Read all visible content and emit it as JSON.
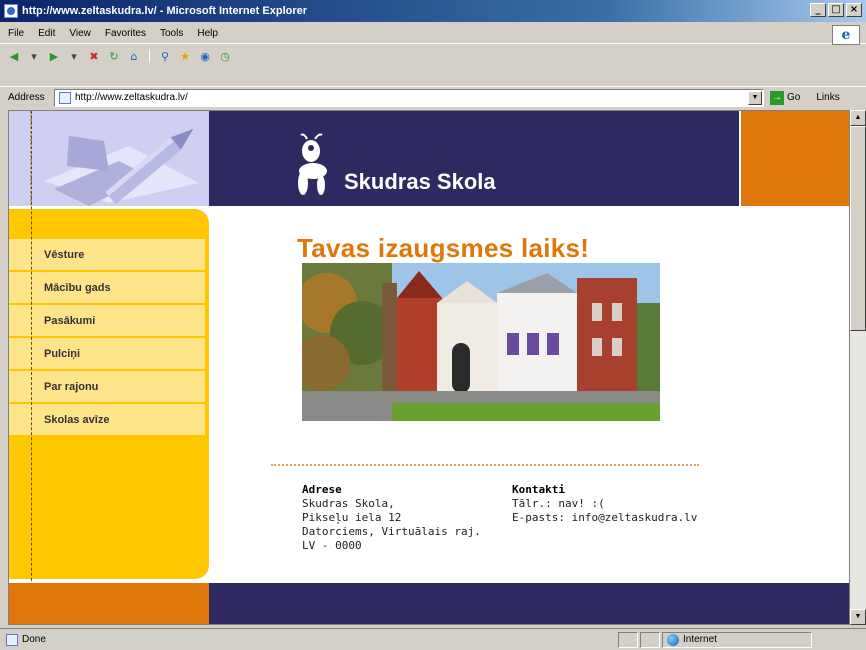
{
  "window": {
    "title": "http://www.zeltaskudra.lv/ - Microsoft Internet Explorer",
    "controls": [
      "_",
      "□",
      "×"
    ]
  },
  "menu": [
    "File",
    "Edit",
    "View",
    "Favorites",
    "Tools",
    "Help"
  ],
  "address": {
    "label": "Address",
    "url": "http://www.zeltaskudra.lv/",
    "go_label": "Go",
    "links_label": "Links"
  },
  "site": {
    "logo_text": "Skudras Skola",
    "tagline": "Tavas izaugsmes laiks!",
    "nav": [
      "Vēsture",
      "Mācību gads",
      "Pasākumi",
      "Pulciņi",
      "Par rajonu",
      "Skolas avīze"
    ],
    "address_heading": "Adrese",
    "address_lines": [
      "Skudras Skola,",
      "Pikseļu iela 12",
      "Datorciems, Virtuālais raj.",
      "LV - 0000"
    ],
    "contacts_heading": "Kontakti",
    "contact_lines": [
      "Tālr.: nav! :(",
      "E-pasts: info@zeltaskudra.lv"
    ]
  },
  "status": {
    "text": "Done",
    "zone": "Internet"
  },
  "colors": {
    "header_navy": "#2e2960",
    "accent_orange": "#e0770a",
    "sidebar_yellow": "#ffc700",
    "nav_item_bg": "#ffe58a"
  }
}
